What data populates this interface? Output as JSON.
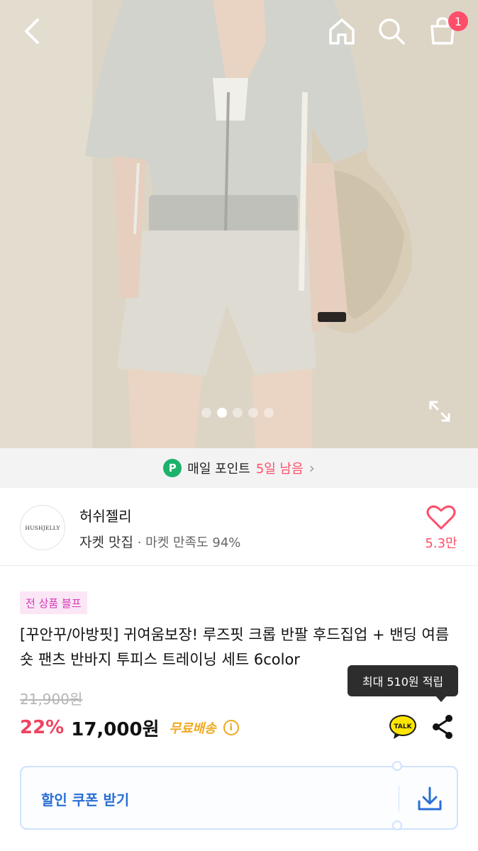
{
  "header": {
    "cart_count": "1",
    "icons": [
      "back-arrow-icon",
      "home-icon",
      "search-icon",
      "cart-icon"
    ]
  },
  "gallery": {
    "image_count": 5,
    "active_index": 1
  },
  "point_banner": {
    "badge": "P",
    "text": "매일 포인트",
    "days": "5일 남음"
  },
  "shop": {
    "logo_text": "HUSHJELLY",
    "name": "허쉬젤리",
    "tag": "자켓 맛집",
    "satisfaction": "· 마켓 만족도 94%",
    "likes": "5.3만"
  },
  "product": {
    "badge": "전 상품 블프",
    "title": "[꾸안꾸/아방핏] 귀여움보장! 루즈핏 크롭 반팔 후드집업 + 밴딩 여름 숏 팬츠 반바지 투피스 트레이닝 세트 6color",
    "original_price": "21,900원",
    "discount": "22%",
    "price": "17,000원",
    "shipping": "무료배송",
    "points_tooltip": "최대 510원 적립",
    "talk_label": "TALK"
  },
  "coupon": {
    "label": "할인 쿠폰 받기"
  },
  "colors": {
    "accent_pink": "#ff4e6a",
    "discount_red": "#f0435f",
    "shipping_yellow": "#f0a81c",
    "coupon_blue": "#2a6fd6",
    "point_green": "#1db26b"
  }
}
